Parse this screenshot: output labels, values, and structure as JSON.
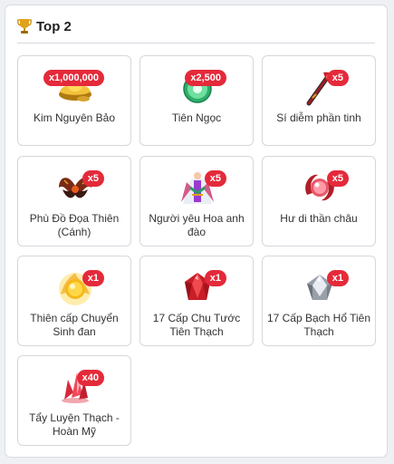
{
  "header": {
    "title": "Top 2",
    "icon": "trophy-icon"
  },
  "colors": {
    "badge": "#e42a3a",
    "border": "#d4d7dc",
    "trophy": "#e0a21a"
  },
  "items": [
    {
      "name": "Kim Nguyên Bảo",
      "quantity": "x1,000,000",
      "icon": "gold-ingot-icon"
    },
    {
      "name": "Tiên Ngọc",
      "quantity": "x2,500",
      "icon": "jade-disc-icon"
    },
    {
      "name": "Sí diễm phần tinh",
      "quantity": "x5",
      "icon": "flame-staff-icon"
    },
    {
      "name": "Phù Đồ Đọa Thiên (Cánh)",
      "quantity": "x5",
      "icon": "dark-wings-icon"
    },
    {
      "name": "Người yêu Hoa anh đào",
      "quantity": "x5",
      "icon": "sakara-costume-icon"
    },
    {
      "name": "Hư di thần châu",
      "quantity": "x5",
      "icon": "divine-orb-icon"
    },
    {
      "name": "Thiên cấp Chuyển Sinh đan",
      "quantity": "x1",
      "icon": "golden-pill-icon"
    },
    {
      "name": "17 Cấp Chu Tước Tiên Thạch",
      "quantity": "x1",
      "icon": "red-gem-icon"
    },
    {
      "name": "17 Cấp Bạch Hổ Tiên Thạch",
      "quantity": "x1",
      "icon": "white-gem-icon"
    },
    {
      "name": "Tẩy Luyện Thạch - Hoàn Mỹ",
      "quantity": "x40",
      "icon": "crystal-shard-icon"
    }
  ]
}
